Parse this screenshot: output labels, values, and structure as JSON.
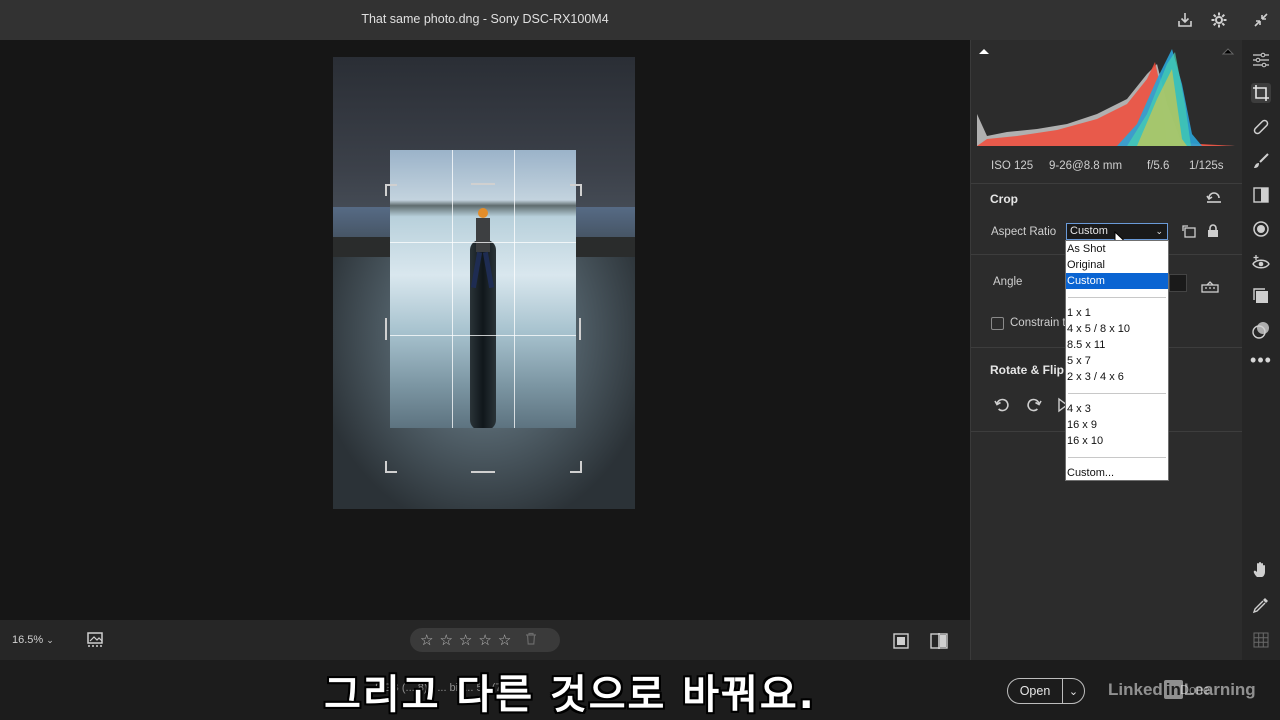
{
  "window": {
    "title": "That same photo.dng  -  Sony DSC-RX100M4",
    "icons": [
      "save-icon",
      "gear-icon",
      "collapse-icon"
    ]
  },
  "histogram": {
    "iso": "ISO 125",
    "lens": "9-26@8.8 mm",
    "aperture": "f/5.6",
    "shutter": "1/125s"
  },
  "crop_panel": {
    "title": "Crop",
    "aspect_ratio_label": "Aspect Ratio",
    "aspect_ratio_value": "Custom",
    "angle_label": "Angle",
    "constrain_label": "Constrain to",
    "rotate_flip_title": "Rotate & Flip"
  },
  "aspect_dropdown": {
    "group1": [
      "As Shot",
      "Original",
      "Custom"
    ],
    "selected": "Custom",
    "group2": [
      "1 x 1",
      "4 x 5 / 8 x 10",
      "8.5 x 11",
      "5 x 7",
      "2 x 3 / 4 x 6"
    ],
    "group3": [
      "4 x 3",
      "16 x 9",
      "16 x 10"
    ],
    "group4": [
      "Custom..."
    ]
  },
  "bottombar": {
    "zoom": "16.5%",
    "stars": [
      "☆",
      "☆",
      "☆",
      "☆",
      "☆"
    ]
  },
  "footer": {
    "info_fragment": "RGB (... 8) - ... bit ... 56 (7... 8)",
    "open_label": "Open",
    "done_label": "Done",
    "watermark_pre": "Linked",
    "watermark_in": "in",
    "watermark_post": "Learning"
  },
  "subtitle": "그리고 다른 것으로 바꿔요.",
  "tool_strip": [
    "edit-sliders-icon",
    "crop-icon",
    "healing-icon",
    "brush-icon",
    "gradient-icon",
    "radial-icon",
    "red-eye-icon",
    "snapshots-icon",
    "presets-icon",
    "more-icon",
    "hand-icon",
    "eyedropper-icon",
    "grid-icon"
  ],
  "colors": {
    "accent": "#0a64d2",
    "panel": "#2c2c2c",
    "canvas": "#161616"
  }
}
